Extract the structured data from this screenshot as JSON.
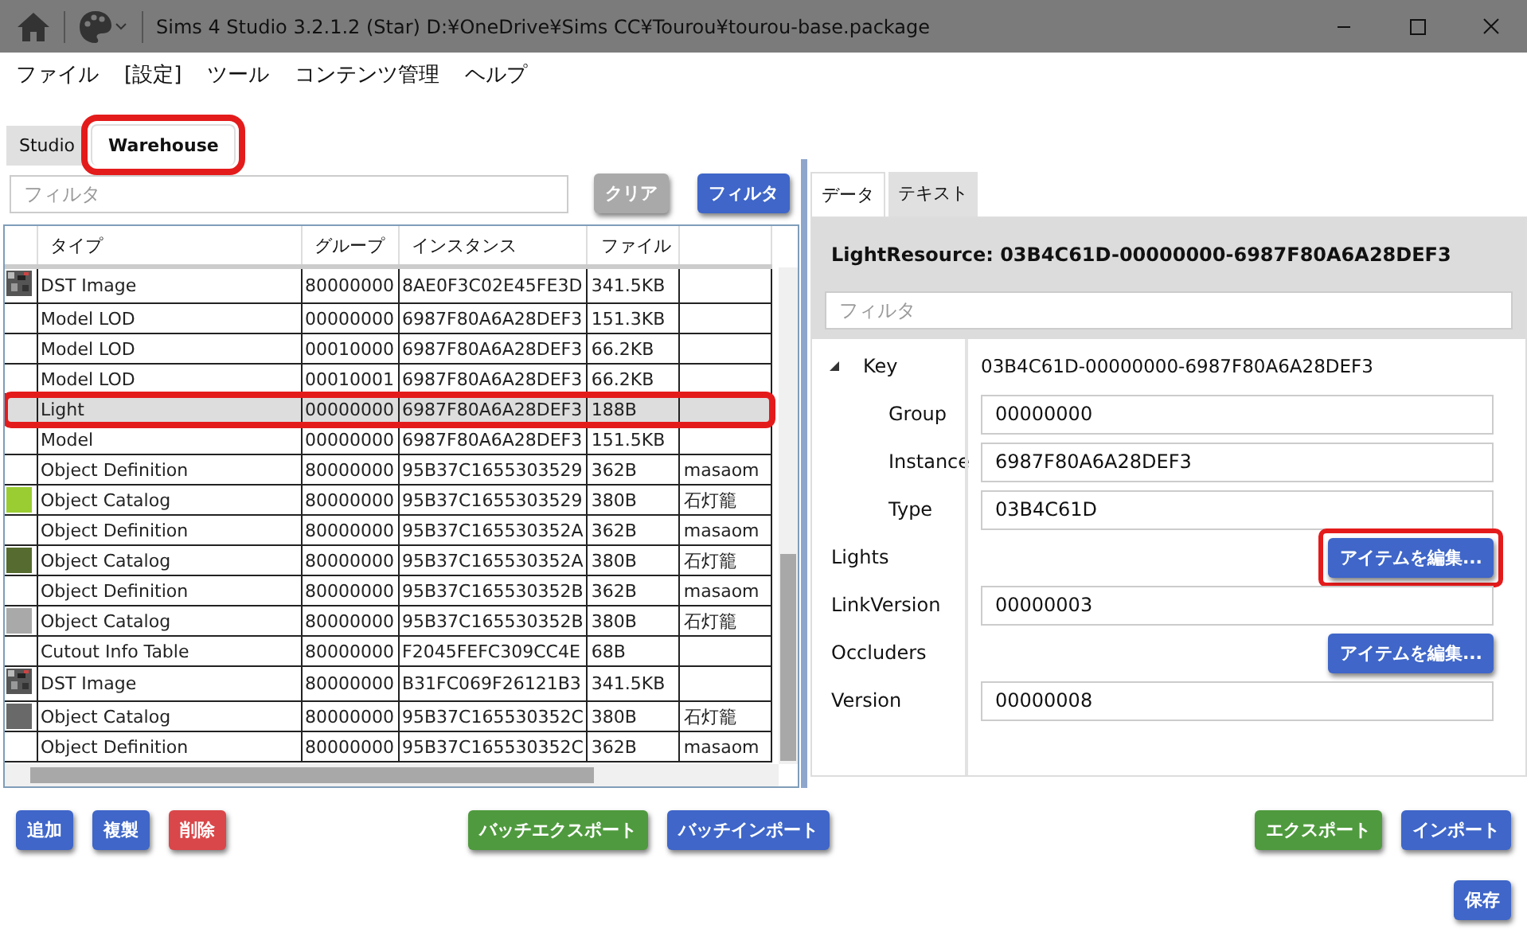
{
  "window": {
    "title": "Sims 4 Studio 3.2.1.2 (Star)  D:¥OneDrive¥Sims CC¥Tourou¥tourou-base.package"
  },
  "menu": [
    "ファイル",
    "[設定]",
    "ツール",
    "コンテンツ管理",
    "ヘルプ"
  ],
  "main_tabs": [
    {
      "label": "Studio",
      "selected": false,
      "highlighted": false
    },
    {
      "label": "Warehouse",
      "selected": true,
      "highlighted": true
    }
  ],
  "filter": {
    "placeholder": "フィルタ",
    "clear_button": "クリア",
    "filter_button": "フィルタ"
  },
  "table": {
    "columns": [
      "タイプ",
      "グループ",
      "インスタンス",
      "ファイル",
      ""
    ],
    "rows": [
      {
        "kind": "texture",
        "cells": [
          "DST Image",
          "80000000",
          "8AE0F3C02E45FE3D",
          "341.5KB",
          ""
        ],
        "selected": false,
        "highlighted": false
      },
      {
        "kind": "plain",
        "cells": [
          "Model LOD",
          "00000000",
          "6987F80A6A28DEF3",
          "151.3KB",
          ""
        ],
        "selected": false,
        "highlighted": false
      },
      {
        "kind": "plain",
        "cells": [
          "Model LOD",
          "00010000",
          "6987F80A6A28DEF3",
          "66.2KB",
          ""
        ],
        "selected": false,
        "highlighted": false
      },
      {
        "kind": "plain",
        "cells": [
          "Model LOD",
          "00010001",
          "6987F80A6A28DEF3",
          "66.2KB",
          ""
        ],
        "selected": false,
        "highlighted": false
      },
      {
        "kind": "plain",
        "cells": [
          "Light",
          "00000000",
          "6987F80A6A28DEF3",
          "188B",
          ""
        ],
        "selected": true,
        "highlighted": true
      },
      {
        "kind": "plain",
        "cells": [
          "Model",
          "00000000",
          "6987F80A6A28DEF3",
          "151.5KB",
          ""
        ],
        "selected": false,
        "highlighted": false
      },
      {
        "kind": "plain",
        "cells": [
          "Object Definition",
          "80000000",
          "95B37C1655303529",
          "362B",
          "masaom"
        ],
        "selected": false,
        "highlighted": false
      },
      {
        "kind": "swatch",
        "color": "#9acd32",
        "cells": [
          "Object Catalog",
          "80000000",
          "95B37C1655303529",
          "380B",
          "石灯籠"
        ],
        "selected": false,
        "highlighted": false
      },
      {
        "kind": "plain",
        "cells": [
          "Object Definition",
          "80000000",
          "95B37C165530352A",
          "362B",
          "masaom"
        ],
        "selected": false,
        "highlighted": false
      },
      {
        "kind": "swatch",
        "color": "#556b2f",
        "cells": [
          "Object Catalog",
          "80000000",
          "95B37C165530352A",
          "380B",
          "石灯籠"
        ],
        "selected": false,
        "highlighted": false
      },
      {
        "kind": "plain",
        "cells": [
          "Object Definition",
          "80000000",
          "95B37C165530352B",
          "362B",
          "masaom"
        ],
        "selected": false,
        "highlighted": false
      },
      {
        "kind": "swatch",
        "color": "#a9a9a9",
        "cells": [
          "Object Catalog",
          "80000000",
          "95B37C165530352B",
          "380B",
          "石灯籠"
        ],
        "selected": false,
        "highlighted": false
      },
      {
        "kind": "plain",
        "cells": [
          "Cutout Info Table",
          "80000000",
          "F2045FEFC309CC4E",
          "68B",
          ""
        ],
        "selected": false,
        "highlighted": false
      },
      {
        "kind": "texture",
        "cells": [
          "DST Image",
          "80000000",
          "B31FC069F26121B3",
          "341.5KB",
          ""
        ],
        "selected": false,
        "highlighted": false
      },
      {
        "kind": "swatch",
        "color": "#696969",
        "cells": [
          "Object Catalog",
          "80000000",
          "95B37C165530352C",
          "380B",
          "石灯籠"
        ],
        "selected": false,
        "highlighted": false
      },
      {
        "kind": "plain",
        "cells": [
          "Object Definition",
          "80000000",
          "95B37C165530352C",
          "362B",
          "masaom"
        ],
        "selected": false,
        "highlighted": false
      }
    ]
  },
  "detail_tabs": [
    {
      "label": "データ",
      "selected": true
    },
    {
      "label": "テキスト",
      "selected": false
    }
  ],
  "detail": {
    "title": "LightResource: 03B4C61D-00000000-6987F80A6A28DEF3",
    "filter_placeholder": "フィルタ",
    "properties": [
      {
        "kind": "group",
        "label": "Key",
        "value": "03B4C61D-00000000-6987F80A6A28DEF3",
        "expanded": true,
        "children": [
          {
            "kind": "field",
            "label": "Group",
            "value": "00000000"
          },
          {
            "kind": "field",
            "label": "Instance",
            "value": "6987F80A6A28DEF3"
          },
          {
            "kind": "field",
            "label": "Type",
            "value": "03B4C61D"
          }
        ]
      },
      {
        "kind": "button",
        "label": "Lights",
        "value": "アイテムを編集...",
        "highlighted": true
      },
      {
        "kind": "field",
        "label": "LinkVersion",
        "value": "00000003"
      },
      {
        "kind": "button",
        "label": "Occluders",
        "value": "アイテムを編集...",
        "highlighted": false
      },
      {
        "kind": "field",
        "label": "Version",
        "value": "00000008"
      }
    ]
  },
  "bottom_left": [
    {
      "label": "追加",
      "color": "#3f66c8"
    },
    {
      "label": "複製",
      "color": "#3f66c8"
    },
    {
      "label": "削除",
      "color": "#d9474a"
    }
  ],
  "bottom_mid": [
    {
      "label": "バッチエクスポート",
      "color": "#4f9a3e"
    },
    {
      "label": "バッチインポート",
      "color": "#3f66c8"
    }
  ],
  "bottom_right": [
    {
      "label": "エクスポート",
      "color": "#4f9a3e"
    },
    {
      "label": "インポート",
      "color": "#3f66c8"
    }
  ],
  "save_button": {
    "label": "保存",
    "color": "#3f66c8"
  }
}
